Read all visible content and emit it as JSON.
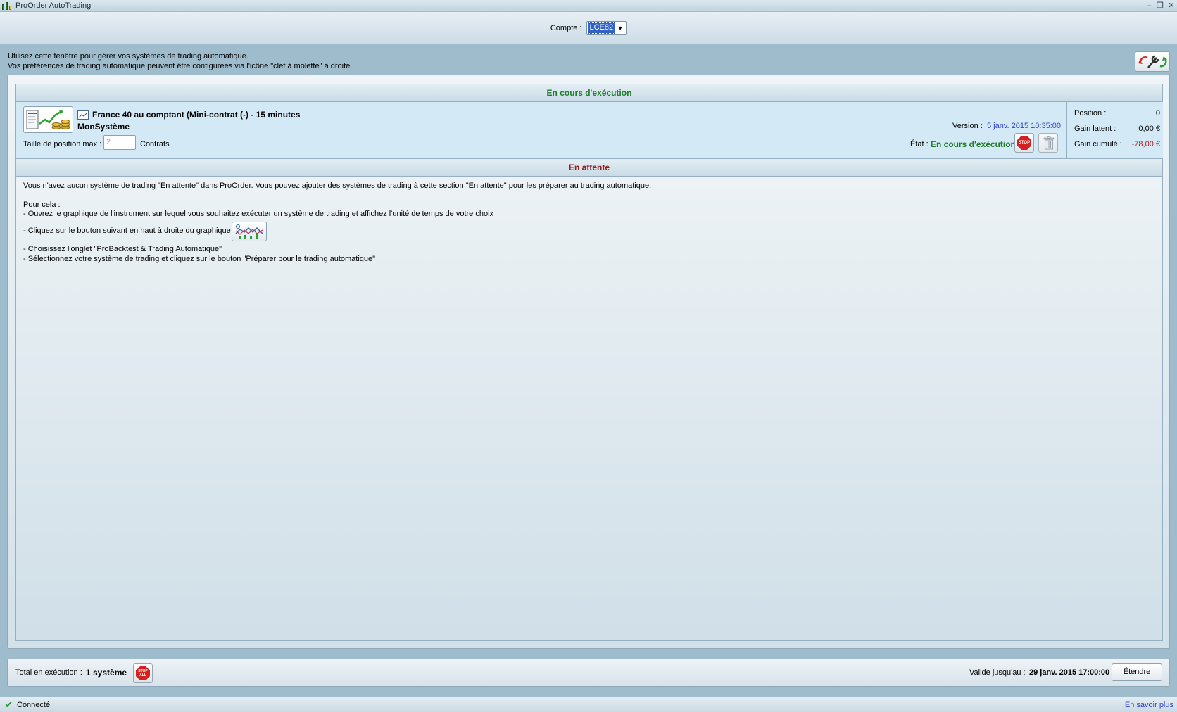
{
  "window": {
    "title": "ProOrder AutoTrading",
    "controls": [
      "–",
      "❐",
      "✕"
    ]
  },
  "account": {
    "label": "Compte :",
    "selected": "LCE82"
  },
  "intro": {
    "line1": "Utilisez cette fenêtre pour gérer vos systèmes de trading automatique.",
    "line2": "Vos préférences de trading automatique peuvent être configurées via l'icône \"clef à molette\" à droite."
  },
  "running": {
    "header": "En cours d'exécution",
    "system": {
      "instrument": "France 40 au comptant (Mini-contrat  (-) - 15 minutes",
      "name": "MonSystème",
      "max_position_label": "Taille de position max :",
      "max_position_value": "2",
      "contracts_label": "Contrats",
      "version_label": "Version :",
      "version_value": "5 janv. 2015 10:35:00",
      "state_label": "État :",
      "state_value": "En cours d'exécution",
      "stop_label": "STOP"
    },
    "stats": {
      "position_label": "Position :",
      "position_value": "0",
      "latent_label": "Gain latent :",
      "latent_value": "0,00 €",
      "cumulative_label": "Gain cumulé :",
      "cumulative_value": "-78,00 €"
    }
  },
  "waiting": {
    "header": "En attente",
    "line1": "Vous n'avez aucun système de trading \"En attente\" dans ProOrder. Vous pouvez ajouter des systèmes de trading à cette section \"En attente\" pour les préparer au trading automatique.",
    "line2": "Pour cela :",
    "line3": "- Ouvrez le graphique de l'instrument sur lequel vous souhaitez exécuter un système de trading et affichez l'unité de temps de votre choix",
    "line4": "- Cliquez sur le bouton suivant en haut à droite du graphique",
    "line5": "- Choisissez l'onglet \"ProBacktest & Trading Automatique\"",
    "line6": "- Sélectionnez votre système de trading et cliquez sur le bouton \"Préparer pour le trading automatique\""
  },
  "footer": {
    "total_label": "Total en exécution :",
    "total_value": "1 système",
    "stop_all_line1": "STOP",
    "stop_all_line2": "ALL",
    "valid_label": "Valide jusqu'au :",
    "valid_value": "29 janv. 2015 17:00:00",
    "extend_label": "Étendre"
  },
  "status": {
    "text": "Connecté",
    "learn_more": "En savoir plus"
  },
  "colors": {
    "running_green": "#1e7d2a",
    "waiting_red": "#9a1d1d",
    "negative": "#a51d1d",
    "link": "#2b3fd0",
    "selection": "#3162c5"
  }
}
